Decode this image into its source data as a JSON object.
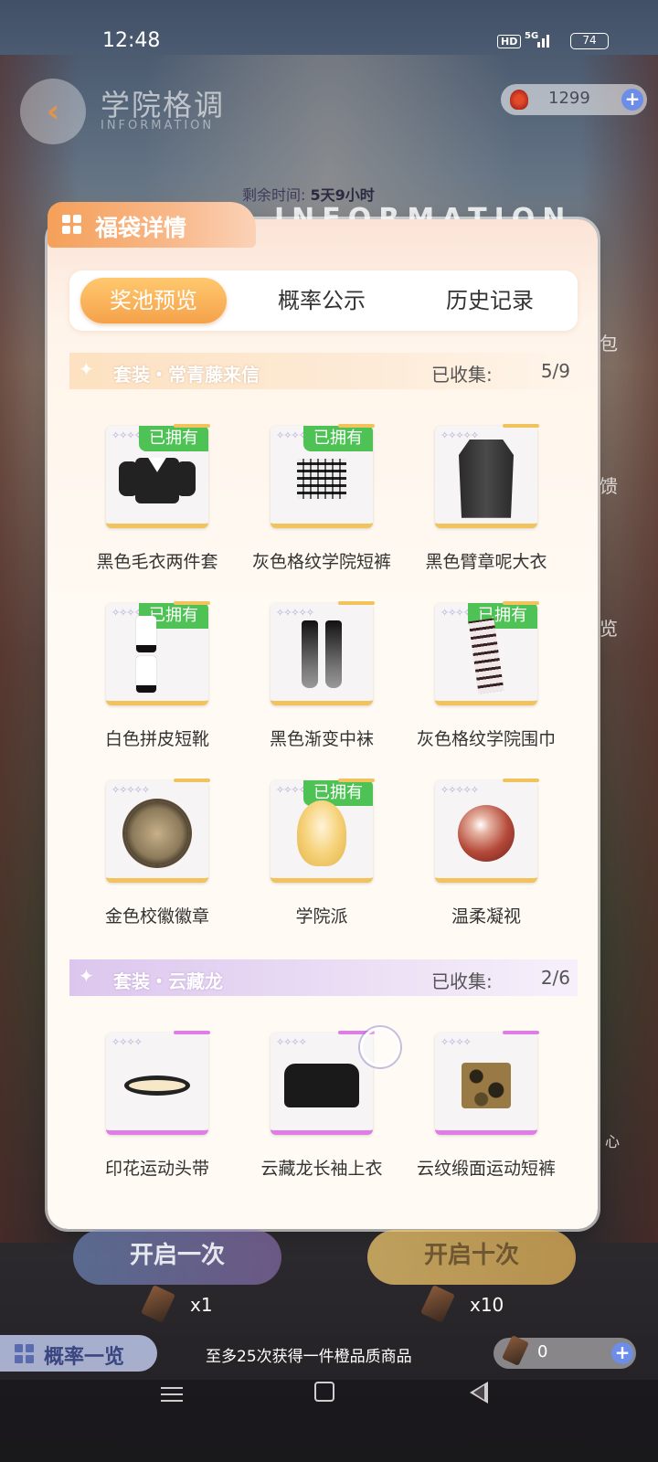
{
  "status_bar": {
    "time": "12:48",
    "hd": "HD",
    "network": "5G",
    "battery": "74"
  },
  "header": {
    "title": "学院格调",
    "subtitle": "INFORMATION",
    "currency_value": "1299",
    "timer_label": "剩余时间:",
    "timer_value": "5天9小时",
    "banner": "INFORMATION"
  },
  "panel": {
    "title": "福袋详情",
    "tabs": [
      {
        "label": "奖池预览",
        "active": true
      },
      {
        "label": "概率公示",
        "active": false
      },
      {
        "label": "历史记录",
        "active": false
      }
    ],
    "owned_label": "已拥有",
    "sets": [
      {
        "name": "套装・常青藤来信",
        "collected_label": "已收集:",
        "count": "5/9",
        "items": [
          {
            "name": "黑色毛衣两件套",
            "owned": true,
            "icon": "sweater-icon"
          },
          {
            "name": "灰色格纹学院短裤",
            "owned": true,
            "icon": "plaid-shorts-icon"
          },
          {
            "name": "黑色臂章呢大衣",
            "owned": false,
            "icon": "coat-icon"
          },
          {
            "name": "白色拼皮短靴",
            "owned": true,
            "icon": "boots-icon"
          },
          {
            "name": "黑色渐变中袜",
            "owned": false,
            "icon": "socks-icon"
          },
          {
            "name": "灰色格纹学院围巾",
            "owned": true,
            "icon": "scarf-icon"
          },
          {
            "name": "金色校徽徽章",
            "owned": false,
            "icon": "badge-icon"
          },
          {
            "name": "学院派",
            "owned": true,
            "icon": "hair-icon"
          },
          {
            "name": "温柔凝视",
            "owned": false,
            "icon": "lens-icon"
          }
        ]
      },
      {
        "name": "套装・云藏龙",
        "collected_label": "已收集:",
        "count": "2/6",
        "items": [
          {
            "name": "印花运动头带",
            "owned": false,
            "icon": "headband-icon"
          },
          {
            "name": "云藏龙长袖上衣",
            "owned": false,
            "icon": "hoodie-icon"
          },
          {
            "name": "云纹缎面运动短裤",
            "owned": false,
            "icon": "camo-shorts-icon"
          }
        ]
      }
    ]
  },
  "side_labels": [
    "包",
    "馈",
    "览",
    "心"
  ],
  "bottom": {
    "open_once": "开启一次",
    "open_ten": "开启十次",
    "qty_once": "x1",
    "qty_ten": "x10",
    "rate_button": "概率一览",
    "guarantee": "至多25次获得一件橙品质商品",
    "ticket_count": "0"
  },
  "colors": {
    "accent": "#f5a24a",
    "owned_green": "#4fc255",
    "gold_rarity": "#f2c35c",
    "purple_rarity": "#e07ce6"
  }
}
